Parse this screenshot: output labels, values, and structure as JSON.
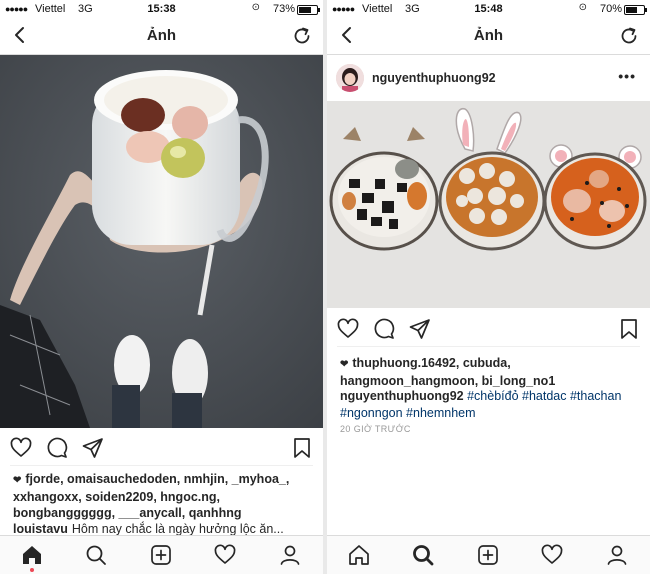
{
  "left": {
    "status": {
      "signal": "●●●●●",
      "carrier": "Viettel",
      "network": "3G",
      "time": "15:38",
      "battery": "73%",
      "battery_level": 0.73
    },
    "nav": {
      "title": "Ảnh"
    },
    "likes": "fjorde, omaisauchedoden, nmhjin, _myhoa_, xxhangoxx, soiden2209, hngoc.ng, bongbangggggg, ___anycall, qanhhng",
    "caption_user": "louistavu",
    "caption_text": "Hôm nay chắc là ngày hưởng lộc ăn..."
  },
  "right": {
    "status": {
      "signal": "●●●●●",
      "carrier": "Viettel",
      "network": "3G",
      "time": "15:48",
      "battery": "70%",
      "battery_level": 0.7
    },
    "nav": {
      "title": "Ảnh"
    },
    "post": {
      "username": "nguyenthuphuong92",
      "more": "•••"
    },
    "likes": "thuphuong.16492, cubuda, hangmoon_hangmoon, bi_long_no1",
    "caption_user": "nguyenthuphuong92",
    "caption_tags": "#chèbíđỏ #hatdac #thachan #ngonngon #nhemnhem",
    "timestamp": "20 GIỜ TRƯỚC"
  },
  "icons": [
    "back-icon",
    "refresh-icon",
    "heart-icon",
    "comment-icon",
    "share-icon",
    "bookmark-icon",
    "home-icon",
    "search-icon",
    "add-icon",
    "activity-icon",
    "profile-icon"
  ],
  "colors": {
    "notification_dot": "#ed4956",
    "hashtag": "#003569",
    "border": "#dbdbdb"
  }
}
